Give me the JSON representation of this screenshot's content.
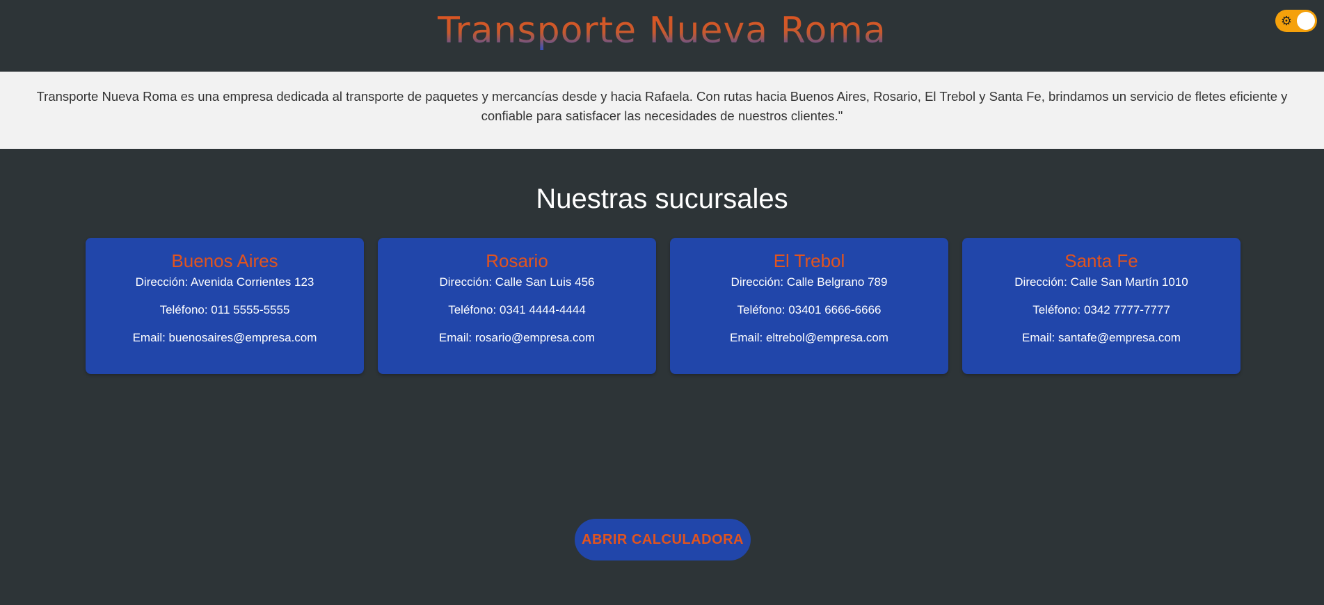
{
  "header": {
    "title": "Transporte Nueva Roma",
    "theme_toggle_icon": "sun-icon"
  },
  "intro": {
    "text": "Transporte Nueva Roma es una empresa dedicada al transporte de paquetes y mercancías desde y hacia Rafaela. Con rutas hacia Buenos Aires, Rosario, El Trebol y Santa Fe, brindamos un servicio de fletes eficiente y confiable para satisfacer las necesidades de nuestros clientes.\""
  },
  "branches": {
    "title": "Nuestras sucursales",
    "items": [
      {
        "name": "Buenos Aires",
        "address": "Dirección: Avenida Corrientes 123",
        "phone": "Teléfono: 011 5555-5555",
        "email": "Email: buenosaires@empresa.com"
      },
      {
        "name": "Rosario",
        "address": "Dirección: Calle San Luis 456",
        "phone": "Teléfono: 0341 4444-4444",
        "email": "Email: rosario@empresa.com"
      },
      {
        "name": "El Trebol",
        "address": "Dirección: Calle Belgrano 789",
        "phone": "Teléfono: 03401 6666-6666",
        "email": "Email: eltrebol@empresa.com"
      },
      {
        "name": "Santa Fe",
        "address": "Dirección: Calle San Martín 1010",
        "phone": "Teléfono: 0342 7777-7777",
        "email": "Email: santafe@empresa.com"
      }
    ]
  },
  "calculator": {
    "button_label": "ABRIR CALCULADORA"
  },
  "colors": {
    "background": "#2d3437",
    "accent": "#e2541e",
    "card": "#2146aa",
    "toggle": "#f5a10b"
  }
}
